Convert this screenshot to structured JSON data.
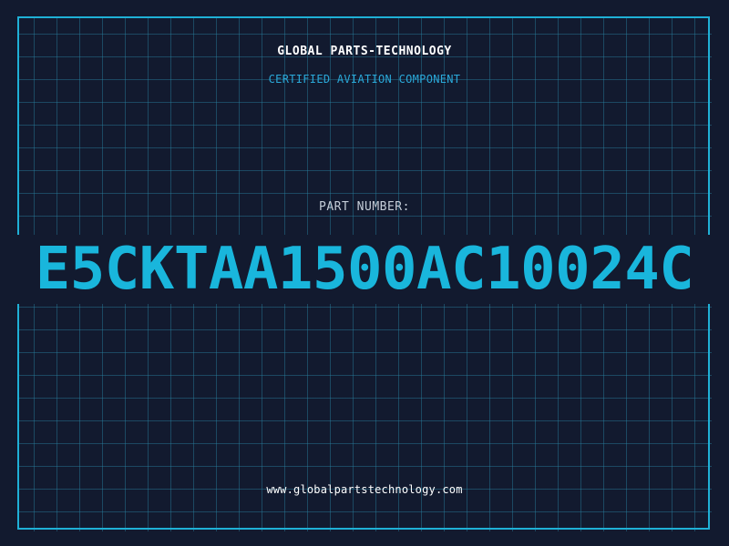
{
  "header": {
    "company": "GLOBAL PARTS-TECHNOLOGY",
    "tagline": "CERTIFIED AVIATION COMPONENT"
  },
  "part": {
    "label": "PART NUMBER:",
    "number": "E5CKTAA1500AC10024C"
  },
  "footer": {
    "website": "www.globalpartstechnology.com"
  },
  "colors": {
    "background": "#121a2f",
    "grid": "#1f6f8a",
    "accent": "#19b6dc",
    "frame": "#1fb0d6"
  }
}
